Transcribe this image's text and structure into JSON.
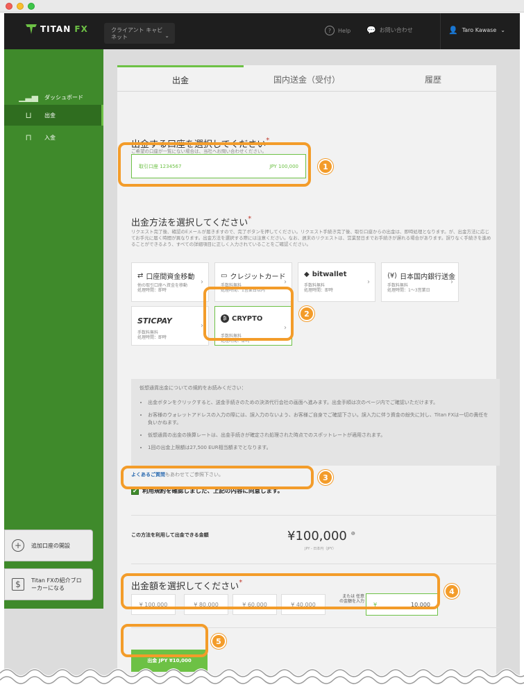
{
  "header": {
    "logo_left": "TITAN",
    "logo_right": "FX",
    "cabinet": "クライアント キャビネット",
    "help": "Help",
    "contact": "お問い合わせ",
    "user": "Taro Kawase"
  },
  "sidebar": {
    "items": [
      {
        "label": "ダッシュボード"
      },
      {
        "label": "出金"
      },
      {
        "label": "入金"
      }
    ],
    "cards": [
      {
        "label": "追加口座の開設"
      },
      {
        "label": "Titan FXの紹介ブローカーになる"
      }
    ]
  },
  "tabs": [
    "出金",
    "国内送金（受付）",
    "履歴"
  ],
  "account_section": {
    "title": "出金する口座を選択してください",
    "required": "*",
    "note": "ご希望の口座が一覧にない場合は、当社へお問い合わせください。",
    "account_name": "取引口座 1234567",
    "account_balance": "JPY 100,000"
  },
  "method_section": {
    "title": "出金方法を選択してください",
    "required": "*",
    "note": "リクエスト完了後、確認のEメールが届きますので、完了ボタンを押してください。リクエスト手続き完了後、取引口座からの出金は、即時処理となります。が、出金方法に応じてお手元に届く時間が異なります。出金方法を選択する際には注意ください。なお、週末のリクエストは、営業翌日までお手続きが遅れる場合があります。誤りなく手続きを進めることができるよう、すべての詳細項目に正しく入力されていることをご確認ください。",
    "methods": [
      {
        "name": "口座間資金移動",
        "icon": "transfer-icon",
        "d1": "他の取引口座へ資金を移動",
        "d2": "処理時間：即時"
      },
      {
        "name": "クレジットカード",
        "icon": "card-icon",
        "d1": "手数料無料",
        "d2": "処理時間：1営業日以内"
      },
      {
        "name": "bitwallet",
        "icon": "wallet-icon",
        "d1": "手数料無料",
        "d2": "処理時間：即時"
      },
      {
        "name": "日本国内銀行送金",
        "icon": "bank-icon",
        "d1": "手数料無料",
        "d2": "処理時間：1〜3営業日"
      },
      {
        "name": "STICPAY",
        "icon": "",
        "d1": "手数料無料",
        "d2": "処理時間：即時"
      },
      {
        "name": "CRYPTO",
        "icon": "bitcoin-icon",
        "d1": "手数料無料",
        "d2": "処理時間：即時"
      }
    ]
  },
  "terms": {
    "intro": "仮想通貨出金についての規約をお読みください：",
    "items": [
      "出金ボタンをクリックすると、送金手続きのための決済代行会社の画面へ進みます。出金手順は次のページ内でご確認いただけます。",
      "お客様のウォレットアドレスの入力の際には、誤入力のないよう、お客様ご自身でご確認下さい。誤入力に伴う資金の紛失に対し、Titan FXは一切の責任を負いかねます。",
      "仮想通貨の出金の換算レートは、出金手続きが確定され処理された時点でのスポットレートが適用されます。",
      "1回の出金上限額は27,500 EUR相当額までとなります。"
    ],
    "faq_link": "よくあるご質問",
    "faq_rest": "もあわせてご参照下さい。",
    "agree": "利用規約を確認しました、上記の内容に同意します。"
  },
  "available": {
    "label": "この方法を利用して出金できる金額",
    "value": "¥100,000",
    "sub": "JPY - 日本円（JPY）"
  },
  "amount_section": {
    "title": "出金額を選択してください",
    "required": "*",
    "presets": [
      "¥ 100,000",
      "¥ 80,000",
      "¥ 60,000",
      "¥ 40,000"
    ],
    "other_label": "または 任意の金額を入力",
    "currency": "¥",
    "other_value": "10,000"
  },
  "submit": {
    "label": "出金 JPY ¥10,000"
  },
  "badges": [
    "1",
    "2",
    "3",
    "4",
    "5"
  ],
  "colors": {
    "brand_green": "#6dc145",
    "sidebar_green": "#3f8a2b",
    "highlight": "#f39c2a"
  }
}
